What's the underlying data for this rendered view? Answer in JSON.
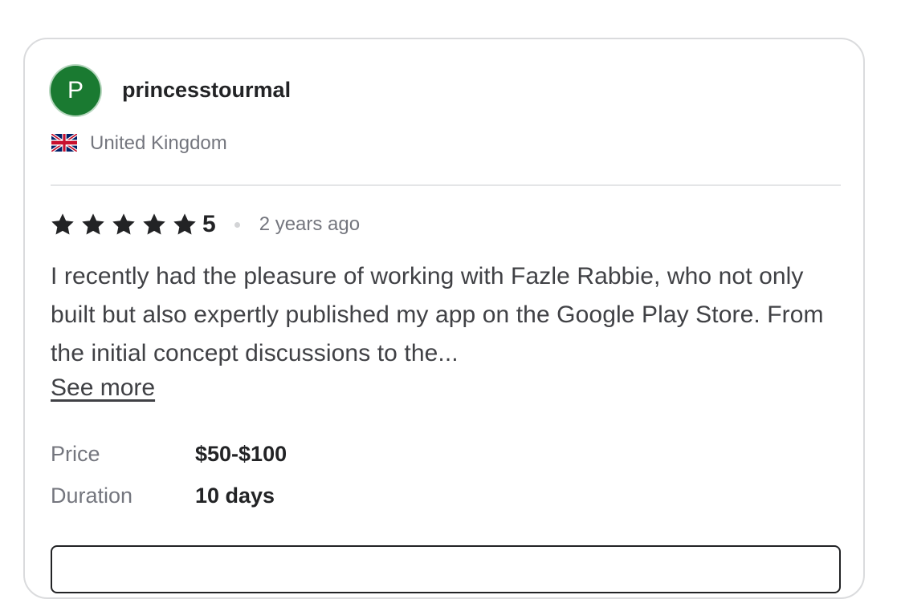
{
  "reviewer": {
    "initial": "P",
    "username": "princesstourmal",
    "country": "United Kingdom",
    "avatar_color": "#1a7a31"
  },
  "review": {
    "rating_stars": 5,
    "rating_label": "5",
    "time_ago": "2 years ago",
    "text": "I recently had the pleasure of working with Fazle Rabbie, who not only built but also expertly published my app on the Google Play Store. From the initial concept discussions to the...",
    "see_more_label": "See more"
  },
  "details": {
    "price_label": "Price",
    "price_value": "$50-$100",
    "duration_label": "Duration",
    "duration_value": "10 days"
  },
  "icons": {
    "flag": "uk-flag-icon",
    "star": "star-icon"
  }
}
